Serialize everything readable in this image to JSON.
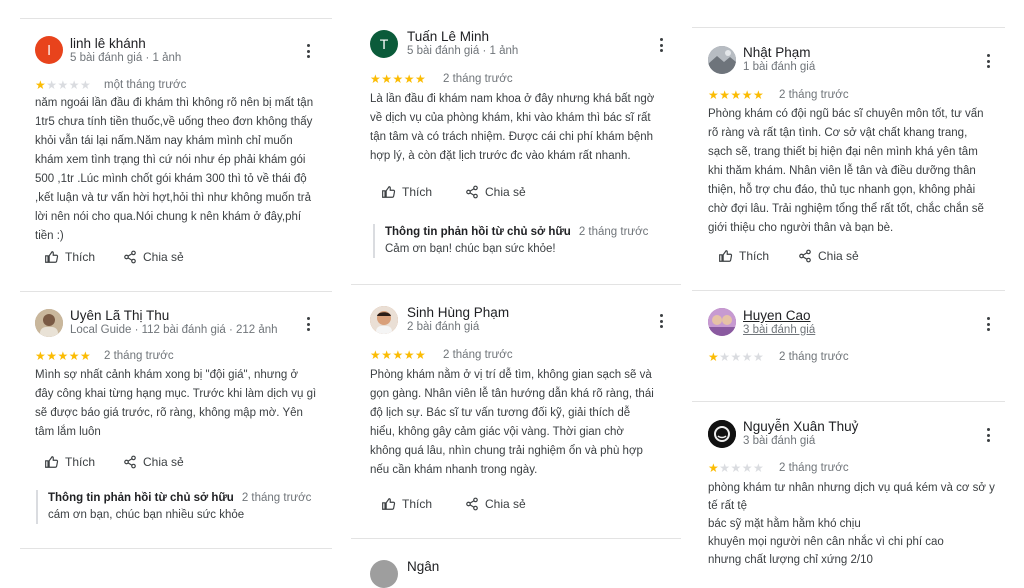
{
  "actions": {
    "like_label": "Thích",
    "share_label": "Chia sẻ"
  },
  "owner_response_title": "Thông tin phản hồi từ chủ sở hữu",
  "columns": [
    {
      "reviews": [
        {
          "name": "linh lê khánh",
          "meta": "5 bài đánh giá · 1 ảnh",
          "avatar": {
            "letter": "l",
            "color": "#e8431c"
          },
          "stars": 1,
          "time": "một tháng trước",
          "lines": [
            "năm ngoái lần đầu đi khám thì không rõ nên bị mất tận",
            "1tr5 chưa tính tiền thuốc,về uống theo đơn không thấy",
            "khỏi vẫn tái lại nấm.Năm nay khám mình chỉ muốn",
            "khám xem tình trạng thì cứ nói như ép phải khám gói",
            "500 ,1tr .Lúc mình chốt gói khám 300 thì tỏ về thái độ",
            ",kết luận và tư vấn hời hợt,hỏi thì như không muốn trả",
            "lời nên nói cho qua.Nói chung k nên khám ở đây,phí",
            "tiền :)"
          ]
        },
        {
          "name": "Uyên Lã Thị Thu",
          "meta": "Local Guide · 112 bài đánh giá · 212 ảnh",
          "avatar": {
            "letter": "",
            "color": "#b9a58a"
          },
          "stars": 5,
          "time": "2 tháng trước",
          "lines": [
            "Mình sợ nhất cảnh khám xong bị \"đội giá\", nhưng ở",
            "đây công khai từng hạng mục. Trước khi làm dịch vụ gì",
            "sẽ được báo giá trước, rõ ràng, không mập mờ. Yên",
            "tâm lắm luôn"
          ],
          "owner_time": "2 tháng trước",
          "owner_text": "cám ơn bạn, chúc bạn nhiều sức khỏe"
        }
      ]
    },
    {
      "reviews": [
        {
          "name": "Tuấn Lê Minh",
          "meta": "5 bài đánh giá · 1 ảnh",
          "avatar": {
            "letter": "T",
            "color": "#0b5b3a"
          },
          "stars": 5,
          "time": "2 tháng trước",
          "lines": [
            "Là lần đầu đi khám nam khoa ở đây nhưng khá bất ngờ",
            "về dịch vụ của phòng khám, khi vào khám thì bác sĩ rất",
            "tận tâm và có trách nhiệm. Được cái chi phí khám bệnh",
            "hợp lý, à còn đặt lịch trước đc vào khám rất nhanh."
          ],
          "owner_time": "2 tháng trước",
          "owner_text": "Cảm ơn bạn! chúc bạn sức khỏe!"
        },
        {
          "name": "Sinh Hùng Phạm",
          "meta": "2 bài đánh giá",
          "avatar": {
            "letter": "",
            "color": "#c98f6a"
          },
          "stars": 5,
          "time": "2 tháng trước",
          "lines": [
            "Phòng khám nằm ở vị trí dễ tìm, không gian sạch sẽ và",
            "gọn gàng. Nhân viên lễ tân hướng dẫn khá rõ ràng, thái",
            "độ lịch sự. Bác sĩ tư vấn tương đối kỹ, giải thích dễ",
            "hiểu, không gây cảm giác vội vàng. Thời gian chờ",
            "không quá lâu, nhìn chung trải nghiệm ổn và phù hợp",
            "nếu cần khám nhanh trong ngày."
          ]
        },
        {
          "name": "Ngân"
        }
      ]
    },
    {
      "reviews": [
        {
          "name": "Nhật Phạm",
          "meta": "1 bài đánh giá",
          "avatar": {
            "letter": "",
            "color": "#8a8f96"
          },
          "stars": 5,
          "time": "2 tháng trước",
          "lines": [
            "Phòng khám có đội ngũ bác sĩ chuyên môn tốt, tư vấn",
            "rõ ràng và rất tận tình. Cơ sở vật chất khang trang,",
            "sạch sẽ, trang thiết bị hiện đại nên mình khá yên tâm",
            "khi thăm khám. Nhân viên lễ tân và điều dưỡng thân",
            "thiện, hỗ trợ chu đáo, thủ tục nhanh gọn, không phải",
            "chờ đợi lâu. Trải nghiệm tổng thể rất tốt, chắc chắn sẽ",
            "giới thiệu cho người thân và bạn bè."
          ]
        },
        {
          "name": "Huyen Cao",
          "meta": "3 bài đánh giá",
          "avatar": {
            "letter": "",
            "color": "#9b6fb0"
          },
          "stars": 1,
          "time": "2 tháng trước"
        },
        {
          "name": "Nguyễn Xuân Thuỷ",
          "meta": "3 bài đánh giá",
          "avatar": {
            "letter": "",
            "color": "#1a1a1a"
          },
          "stars": 1,
          "time": "2 tháng trước",
          "lines": [
            "phòng khám tư nhân nhưng dịch vụ quá kém và cơ sở y",
            "tế rất tệ",
            "bác sỹ mặt hằm hằm khó chịu",
            "khuyên mọi người nên cân nhắc vì chi phí cao",
            "nhưng chất lượng chỉ xứng 2/10"
          ]
        }
      ]
    }
  ]
}
